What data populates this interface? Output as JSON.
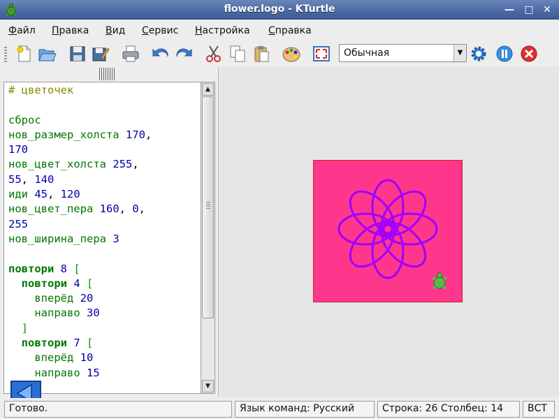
{
  "window": {
    "title": "flower.logo - KTurtle",
    "controls": [
      "minimize-icon",
      "maximize-icon",
      "close-icon"
    ]
  },
  "menubar": {
    "items": [
      {
        "accel": "Ф",
        "rest": "айл"
      },
      {
        "accel": "П",
        "rest": "равка"
      },
      {
        "accel": "В",
        "rest": "ид"
      },
      {
        "accel": "С",
        "rest": "ервис"
      },
      {
        "accel": "Н",
        "rest": "астройка"
      },
      {
        "accel": "С",
        "rest": "правка"
      }
    ]
  },
  "toolbar": {
    "icons": [
      "new-file-icon",
      "open-icon",
      "save-icon",
      "save-as-icon",
      "print-icon",
      "undo-icon",
      "redo-icon",
      "cut-icon",
      "copy-icon",
      "paste-icon",
      "color-picker-icon",
      "fullscreen-icon",
      "run-icon",
      "pause-icon",
      "stop-icon"
    ],
    "speed_select": {
      "value": "Обычная"
    }
  },
  "editor": {
    "lines": [
      [
        {
          "t": "# цветочек",
          "c": "comment"
        }
      ],
      [],
      [
        {
          "t": "сброс",
          "c": "kw"
        }
      ],
      [
        {
          "t": "нов_размер_холста ",
          "c": "kw"
        },
        {
          "t": "170",
          "c": "num"
        },
        {
          "t": ",",
          "c": "plain"
        }
      ],
      [
        {
          "t": "170",
          "c": "num"
        }
      ],
      [
        {
          "t": "нов_цвет_холста ",
          "c": "kw"
        },
        {
          "t": "255",
          "c": "num"
        },
        {
          "t": ",",
          "c": "plain"
        }
      ],
      [
        {
          "t": "55",
          "c": "num"
        },
        {
          "t": ", ",
          "c": "plain"
        },
        {
          "t": "140",
          "c": "num"
        }
      ],
      [
        {
          "t": "иди ",
          "c": "kw"
        },
        {
          "t": "45",
          "c": "num"
        },
        {
          "t": ", ",
          "c": "plain"
        },
        {
          "t": "120",
          "c": "num"
        }
      ],
      [
        {
          "t": "нов_цвет_пера ",
          "c": "kw"
        },
        {
          "t": "160",
          "c": "num"
        },
        {
          "t": ", ",
          "c": "plain"
        },
        {
          "t": "0",
          "c": "num"
        },
        {
          "t": ",",
          "c": "plain"
        }
      ],
      [
        {
          "t": "255",
          "c": "num"
        }
      ],
      [
        {
          "t": "нов_ширина_пера ",
          "c": "kw"
        },
        {
          "t": "3",
          "c": "num"
        }
      ],
      [],
      [
        {
          "t": "повтори",
          "c": "kwb"
        },
        {
          "t": " ",
          "c": "plain"
        },
        {
          "t": "8",
          "c": "num"
        },
        {
          "t": " [",
          "c": "br"
        }
      ],
      [
        {
          "t": "  ",
          "c": "plain"
        },
        {
          "t": "повтори",
          "c": "kwb"
        },
        {
          "t": " ",
          "c": "plain"
        },
        {
          "t": "4",
          "c": "num"
        },
        {
          "t": " [",
          "c": "br"
        }
      ],
      [
        {
          "t": "    вперёд ",
          "c": "kw"
        },
        {
          "t": "20",
          "c": "num"
        }
      ],
      [
        {
          "t": "    направо ",
          "c": "kw"
        },
        {
          "t": "30",
          "c": "num"
        }
      ],
      [
        {
          "t": "  ]",
          "c": "br"
        }
      ],
      [
        {
          "t": "  ",
          "c": "plain"
        },
        {
          "t": "повтори",
          "c": "kwb"
        },
        {
          "t": " ",
          "c": "plain"
        },
        {
          "t": "7",
          "c": "num"
        },
        {
          "t": " [",
          "c": "br"
        }
      ],
      [
        {
          "t": "    вперёд ",
          "c": "kw"
        },
        {
          "t": "10",
          "c": "num"
        }
      ],
      [
        {
          "t": "    направо ",
          "c": "kw"
        },
        {
          "t": "15",
          "c": "num"
        }
      ]
    ]
  },
  "canvas": {
    "background": "#ff378c",
    "pen_color": "#a000ff"
  },
  "statusbar": {
    "message": "Готово.",
    "language": "Язык команд: Русский",
    "position": "Строка: 26 Столбец: 14",
    "mode": "ВСТ"
  }
}
